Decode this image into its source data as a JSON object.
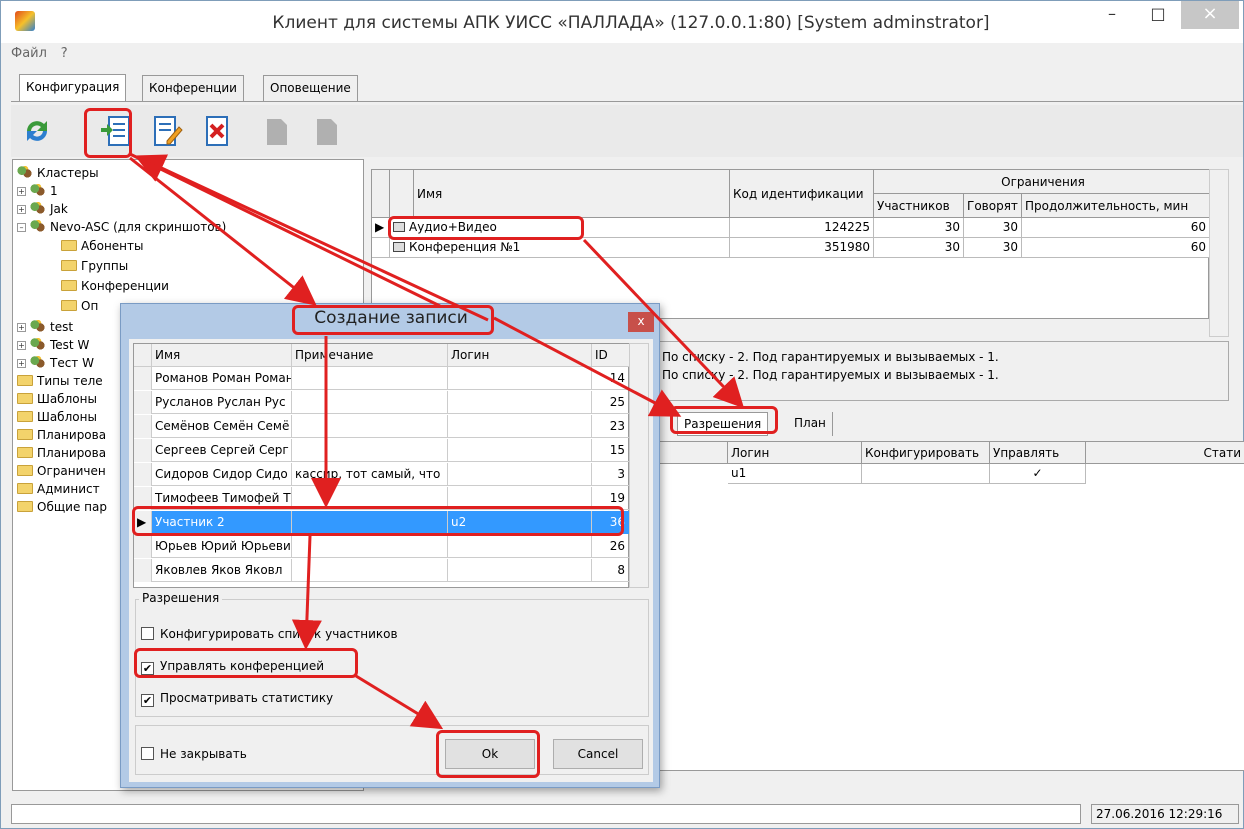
{
  "window": {
    "title": "Клиент для системы АПК УИСС «ПАЛЛАДА» (127.0.0.1:80) [System adminstrator]",
    "minimize": "–",
    "maximize": "□",
    "close": "×"
  },
  "menu": [
    "Файл",
    "?"
  ],
  "tabs": [
    "Конфигурация",
    "Конференции",
    "Оповещение"
  ],
  "tree": {
    "root": "Кластеры",
    "items": [
      "1",
      "Jak",
      "Nevo-ASC (для скриншотов)",
      "Абоненты",
      "Группы",
      "Конференции",
      "Оп",
      "test",
      "Test W",
      "Тест W",
      "Типы теле",
      "Шаблоны",
      "Шаблоны",
      "Планирова",
      "Планирова",
      "Ограничен",
      "Админист",
      "Общие пар"
    ]
  },
  "conf_grid": {
    "col_name": "Имя",
    "col_code": "Код идентификации",
    "col_limits": "Ограничения",
    "col_participants": "Участников",
    "col_speakers": "Говорят",
    "col_duration": "Продолжительность, мин",
    "rows": [
      {
        "name": "Аудио+Видео",
        "code": "124225",
        "participants": "30",
        "speakers": "30",
        "duration": "60"
      },
      {
        "name": "Конференция №1",
        "code": "351980",
        "participants": "30",
        "speakers": "30",
        "duration": "60"
      }
    ]
  },
  "info": {
    "line1": "По списку - 2. Под гарантируемых и вызываемых - 1.",
    "line2": "По списку - 2. Под гарантируемых и вызываемых - 1."
  },
  "lower_tabs": [
    "Разрешения",
    "План"
  ],
  "perm_grid": {
    "col_login": "Логин",
    "col_configure": "Конфигурировать",
    "col_manage": "Управлять",
    "col_stats": "Стати",
    "rows": [
      {
        "login": "u1",
        "manage": "✓"
      }
    ]
  },
  "status": {
    "datetime": "27.06.2016 12:29:16"
  },
  "dialog": {
    "title": "Создание записи",
    "close": "x",
    "col_name": "Имя",
    "col_note": "Примечание",
    "col_login": "Логин",
    "col_id": "ID",
    "rows": [
      {
        "name": "Романов Роман Роман",
        "note": "",
        "login": "",
        "id": "14"
      },
      {
        "name": "Русланов Руслан Рус",
        "note": "",
        "login": "",
        "id": "25"
      },
      {
        "name": "Семёнов Семён Семё",
        "note": "",
        "login": "",
        "id": "23"
      },
      {
        "name": "Сергеев Сергей Серг",
        "note": "",
        "login": "",
        "id": "15"
      },
      {
        "name": "Сидоров Сидор Сидо",
        "note": "кассир, тот самый, что",
        "login": "",
        "id": "3"
      },
      {
        "name": "Тимофеев Тимофей Т",
        "note": "",
        "login": "",
        "id": "19"
      },
      {
        "name": "Участник 2",
        "note": "",
        "login": "u2",
        "id": "36"
      },
      {
        "name": "Юрьев Юрий Юрьеви",
        "note": "",
        "login": "",
        "id": "26"
      },
      {
        "name": "Яковлев Яков Яковл",
        "note": "",
        "login": "",
        "id": "8"
      }
    ],
    "perm_legend": "Разрешения",
    "perm_configure": "Конфигурировать список участников",
    "perm_manage": "Управлять конференцией",
    "perm_stats": "Просматривать статистику",
    "perm_configure_checked": "",
    "perm_manage_checked": "✔",
    "perm_stats_checked": "✔",
    "keep_open": "Не закрывать",
    "ok": "Ok",
    "cancel": "Cancel"
  }
}
